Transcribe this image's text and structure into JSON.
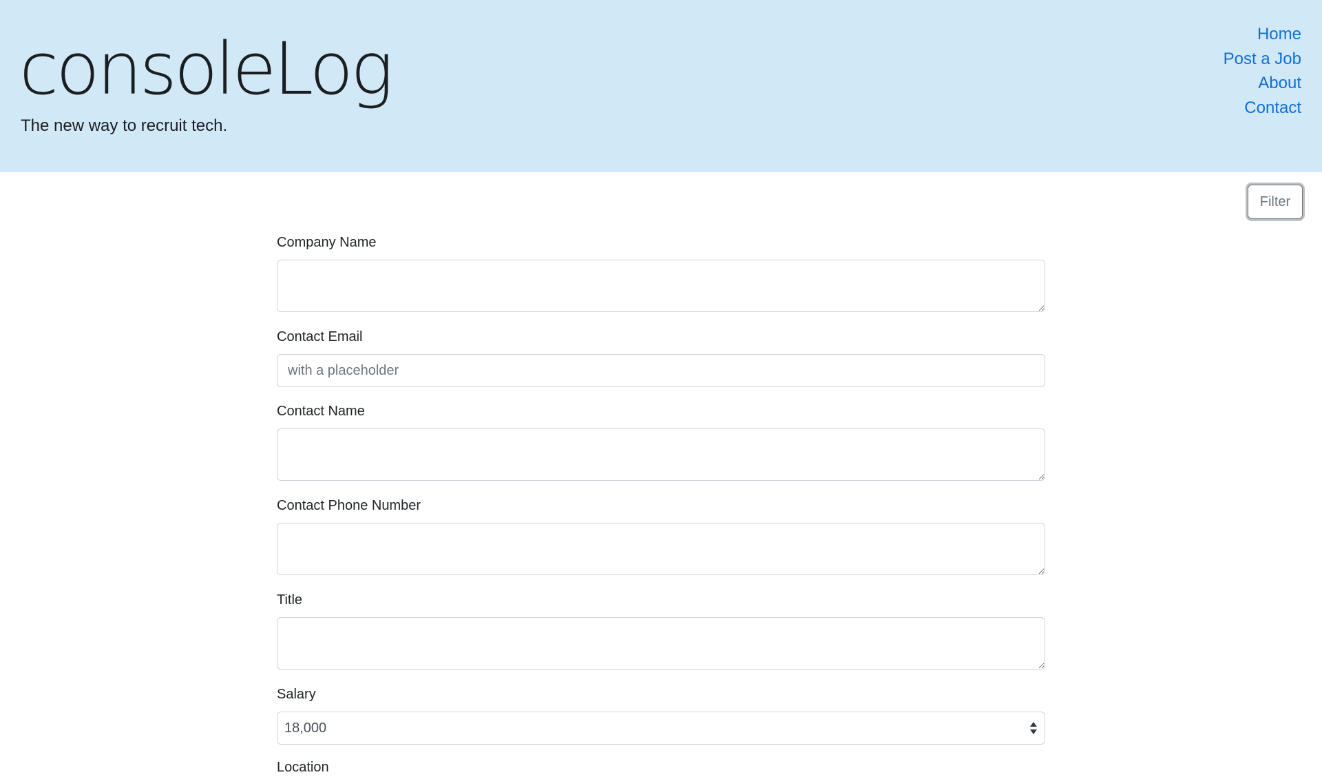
{
  "header": {
    "brand_title": "consoleLog",
    "tagline": "The new way to recruit tech.",
    "nav": [
      "Home",
      "Post a Job",
      "About",
      "Contact"
    ]
  },
  "toolbar": {
    "filter_label": "Filter"
  },
  "form": {
    "company_name_label": "Company Name",
    "contact_email_label": "Contact Email",
    "contact_email_placeholder": "with a placeholder",
    "contact_name_label": "Contact Name",
    "contact_phone_label": "Contact Phone Number",
    "title_label": "Title",
    "salary_label": "Salary",
    "salary_value": "18,000",
    "location_label": "Location"
  },
  "colors": {
    "header_bg": "#d1e8f6",
    "nav_link": "#0d6fd8",
    "filter_border": "#6c757d"
  }
}
